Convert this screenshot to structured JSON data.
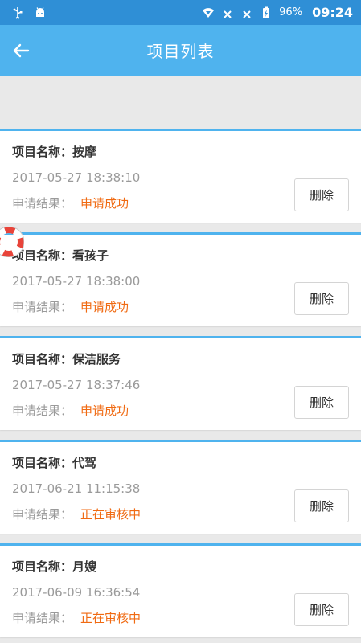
{
  "status_bar": {
    "battery": "96%",
    "time": "09:24",
    "icons": [
      "usb-icon",
      "android-icon",
      "wifi-icon",
      "signal-off-icon",
      "signal-off-icon",
      "battery-charging-icon"
    ]
  },
  "header": {
    "title": "项目列表",
    "back_icon": "back-arrow-icon"
  },
  "colors": {
    "status_bar": "#2f8fd6",
    "app_bar": "#4fb3ee",
    "card_accent": "#4fb3ee",
    "result_text": "#f06a12",
    "background": "#e9e9e9"
  },
  "items": [
    {
      "name": "项目名称：按摩",
      "date": "2017-05-27 18:38:10",
      "result_label": "申请结果：",
      "result": "申请成功",
      "delete_label": "删除"
    },
    {
      "name": "项目名称：看孩子",
      "date": "2017-05-27 18:38:00",
      "result_label": "申请结果：",
      "result": "申请成功",
      "delete_label": "删除"
    },
    {
      "name": "项目名称：保洁服务",
      "date": "2017-05-27 18:37:46",
      "result_label": "申请结果：",
      "result": "申请成功",
      "delete_label": "删除"
    },
    {
      "name": "项目名称：代驾",
      "date": "2017-06-21 11:15:38",
      "result_label": "申请结果：",
      "result": "正在审核中",
      "delete_label": "删除"
    },
    {
      "name": "项目名称：月嫂",
      "date": "2017-06-09 16:36:54",
      "result_label": "申请结果：",
      "result": "正在审核中",
      "delete_label": "删除"
    }
  ]
}
